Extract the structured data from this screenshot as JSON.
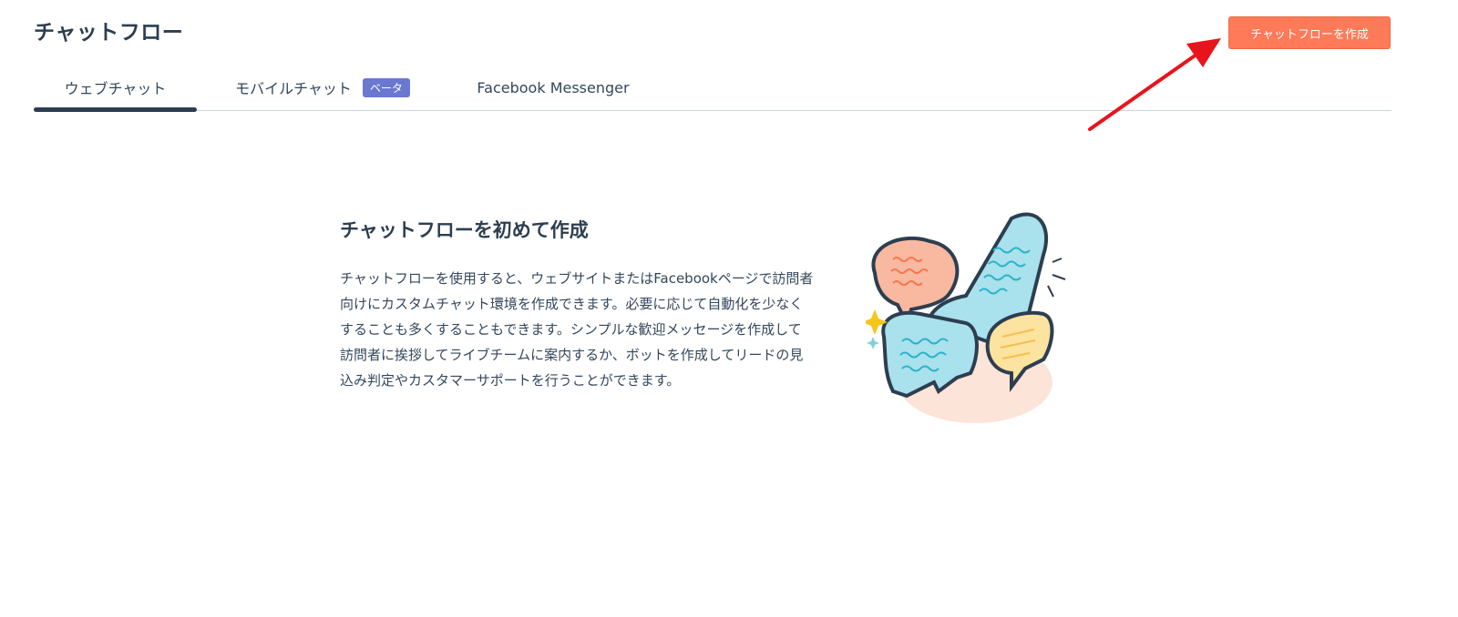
{
  "header": {
    "title": "チャットフロー",
    "create_button_label": "チャットフローを作成"
  },
  "tabs": [
    {
      "label": "ウェブチャット",
      "active": true
    },
    {
      "label": "モバイルチャット",
      "badge": "ベータ",
      "active": false
    },
    {
      "label": "Facebook Messenger",
      "active": false
    }
  ],
  "empty_state": {
    "title": "チャットフローを初めて作成",
    "body": "チャットフローを使用すると、ウェブサイトまたはFacebookページで訪問者向けにカスタムチャット環境を作成できます。必要に応じて自動化を少なくすることも多くすることもできます。シンプルな歓迎メッセージを作成して訪問者に挨拶してライブチームに案内するか、ボットを作成してリードの見込み判定やカスタマーサポートを行うことができます。",
    "illustration_icon": "chat-bubbles-illustration"
  },
  "colors": {
    "primary_button": "#ff7a59",
    "beta_badge": "#6a78d1",
    "annotation_arrow": "#e8141c"
  }
}
